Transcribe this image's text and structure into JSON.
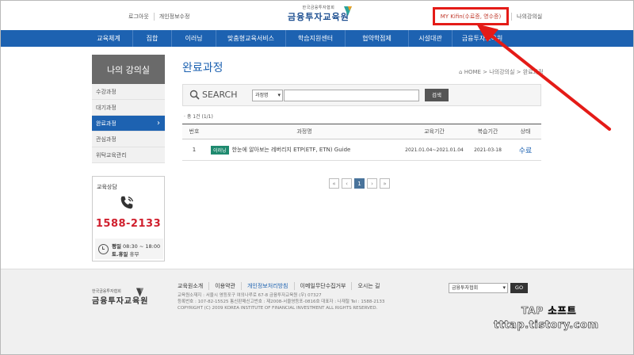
{
  "header": {
    "util_links": [
      "로그아웃",
      "개인정보수정"
    ],
    "logo_small": "한국금융투자협회",
    "logo_big": "금융투자교육원",
    "my_kifin": "MY Kifin(수료증, 영수증)",
    "my_lecture": "나의강의실"
  },
  "nav": {
    "items": [
      "교육체계",
      "집합",
      "이러닝",
      "맞춤형교육서비스",
      "학습지원센터",
      "협약학점제",
      "시설대관",
      "금융투자교육원"
    ]
  },
  "sidebar": {
    "title": "나의 강의실",
    "items": [
      "수강과정",
      "대기과정",
      "완료과정",
      "관심과정",
      "위탁교육관리"
    ],
    "active_index": 2,
    "consult_title": "교육상담",
    "tel": "1588-2133",
    "hours_weekday_label": "평일",
    "hours_weekday": "08:30 ~ 18:00",
    "hours_weekend_label": "토.휴일",
    "hours_weekend": "휴무"
  },
  "main": {
    "title": "완료과정",
    "breadcrumb": "HOME > 나의강의실 > 완료과정",
    "search_label": "SEARCH",
    "search_select": "과정명",
    "search_input": "",
    "search_button": "검색",
    "count": "· 총 1건 (1/1)",
    "columns": [
      "번호",
      "과정명",
      "교육기간",
      "복습기간",
      "상태"
    ],
    "rows": [
      {
        "no": "1",
        "badge": "이러닝",
        "course": "한눈에 알아보는 레버리지 ETP(ETF, ETN) Guide",
        "period": "2021.01.04~2021.01.04",
        "review": "2021-03-18",
        "status": "수료"
      }
    ],
    "pager": [
      "«",
      "‹",
      "1",
      "›",
      "»"
    ],
    "current_page": "1"
  },
  "footer": {
    "logo_small": "한국금융투자협회",
    "logo_big": "금융투자교육원",
    "links": [
      "교육원소개",
      "이용약관",
      "개인정보처리방침",
      "이메일무단수집거부",
      "오시는 길"
    ],
    "address": "교육원소재지 : 서울시 영등포구 여의나루로 67-8 금융투자교육원 (우) 07327",
    "reg": "등록번호 : 107-82-15525 통신판매신고번호 : 제2008-서울영등포-0816호 대표자 : 나재철 Tel : 1588-2133",
    "copyright": "COPYRIGHT (C) 2009 KOREA INSTITUTE OF FINANCIAL INVESTMENT ALL RIGHTS RESERVED.",
    "family_select": "금융투자협회",
    "go": "GO"
  },
  "watermark": {
    "line1": "TAP 소프트",
    "line2": "tttap.tistory.com"
  },
  "colors": {
    "nav_blue": "#1d62b1",
    "annotation_red": "#e41b17",
    "badge_green": "#1f8a6f",
    "tel_red": "#d0202e"
  }
}
